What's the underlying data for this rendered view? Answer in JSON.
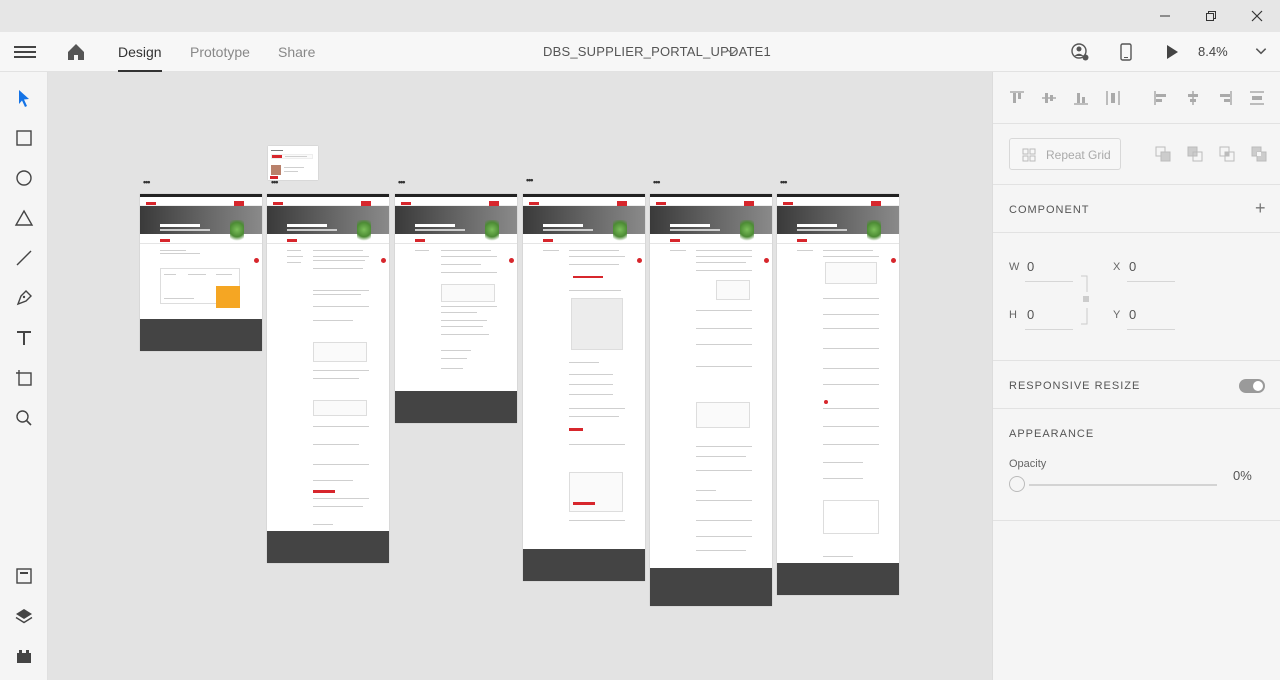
{
  "window": {
    "minimize": "—",
    "maximize": "❐",
    "close": "✕"
  },
  "menu": {
    "tabs": [
      "Design",
      "Prototype",
      "Share"
    ],
    "active_tab": "Design",
    "document_title": "DBS_SUPPLIER_PORTAL_UPDATE1",
    "zoom": "8.4%"
  },
  "toolbar": {
    "tools": [
      "select-icon",
      "rectangle-icon",
      "ellipse-icon",
      "polygon-icon",
      "line-icon",
      "pen-icon",
      "text-icon",
      "artboard-icon",
      "zoom-icon"
    ],
    "bottom": [
      "assets-icon",
      "layers-icon",
      "plugins-icon"
    ]
  },
  "panel": {
    "repeat_grid": "Repeat Grid",
    "component_title": "COMPONENT",
    "component_add": "+",
    "w_label": "W",
    "w_value": "0",
    "h_label": "H",
    "h_value": "0",
    "x_label": "X",
    "x_value": "0",
    "y_label": "Y",
    "y_value": "0",
    "responsive_resize": "RESPONSIVE RESIZE",
    "responsive_on": true,
    "appearance": "APPEARANCE",
    "opacity_label": "Opacity",
    "opacity_value": "0%",
    "opacity_level": 0
  },
  "artboards": [
    {
      "name": "artboard-1",
      "dots": "•••"
    },
    {
      "name": "artboard-2",
      "dots": "•••"
    },
    {
      "name": "artboard-3",
      "dots": "•••"
    },
    {
      "name": "artboard-4",
      "dots": "•••"
    },
    {
      "name": "artboard-5",
      "dots": "•••"
    },
    {
      "name": "artboard-6",
      "dots": "•••"
    }
  ],
  "colors": {
    "brand_red": "#d7262c",
    "footer": "#444444",
    "accent_orange": "#f5a623"
  }
}
